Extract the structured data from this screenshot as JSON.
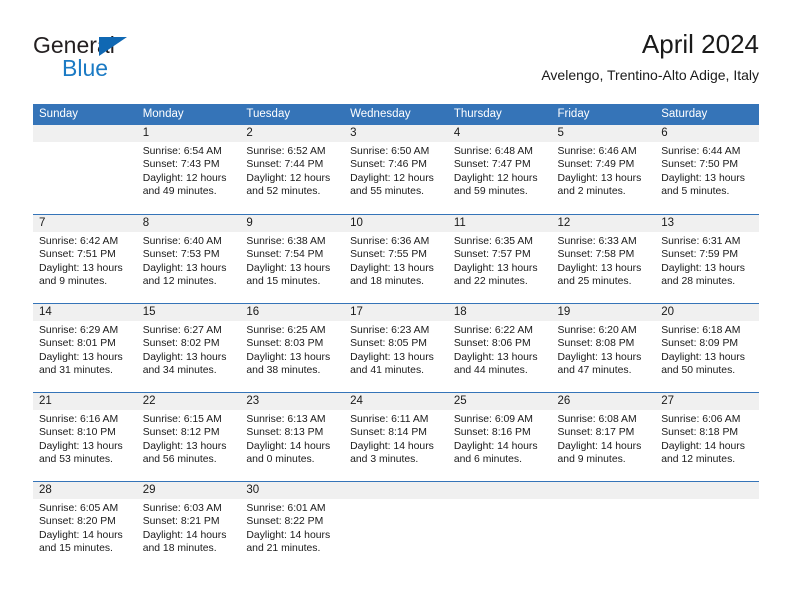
{
  "brand": {
    "name_part1": "General",
    "name_part2": "Blue",
    "triangle_icon": "triangle-icon",
    "accent_color": "#1b7ac4",
    "dark_color": "#231f20"
  },
  "header": {
    "title": "April 2024",
    "subtitle": "Avelengo, Trentino-Alto Adige, Italy"
  },
  "calendar": {
    "header_bg": "#3574b8",
    "day_band_bg": "#f0f0f0",
    "weekday_headers": [
      "Sunday",
      "Monday",
      "Tuesday",
      "Wednesday",
      "Thursday",
      "Friday",
      "Saturday"
    ],
    "weeks": [
      [
        {
          "day": "",
          "sunrise": "",
          "sunset": "",
          "daylight_line1": "",
          "daylight_line2": "",
          "empty": true
        },
        {
          "day": "1",
          "sunrise": "Sunrise: 6:54 AM",
          "sunset": "Sunset: 7:43 PM",
          "daylight_line1": "Daylight: 12 hours",
          "daylight_line2": "and 49 minutes."
        },
        {
          "day": "2",
          "sunrise": "Sunrise: 6:52 AM",
          "sunset": "Sunset: 7:44 PM",
          "daylight_line1": "Daylight: 12 hours",
          "daylight_line2": "and 52 minutes."
        },
        {
          "day": "3",
          "sunrise": "Sunrise: 6:50 AM",
          "sunset": "Sunset: 7:46 PM",
          "daylight_line1": "Daylight: 12 hours",
          "daylight_line2": "and 55 minutes."
        },
        {
          "day": "4",
          "sunrise": "Sunrise: 6:48 AM",
          "sunset": "Sunset: 7:47 PM",
          "daylight_line1": "Daylight: 12 hours",
          "daylight_line2": "and 59 minutes."
        },
        {
          "day": "5",
          "sunrise": "Sunrise: 6:46 AM",
          "sunset": "Sunset: 7:49 PM",
          "daylight_line1": "Daylight: 13 hours",
          "daylight_line2": "and 2 minutes."
        },
        {
          "day": "6",
          "sunrise": "Sunrise: 6:44 AM",
          "sunset": "Sunset: 7:50 PM",
          "daylight_line1": "Daylight: 13 hours",
          "daylight_line2": "and 5 minutes."
        }
      ],
      [
        {
          "day": "7",
          "sunrise": "Sunrise: 6:42 AM",
          "sunset": "Sunset: 7:51 PM",
          "daylight_line1": "Daylight: 13 hours",
          "daylight_line2": "and 9 minutes."
        },
        {
          "day": "8",
          "sunrise": "Sunrise: 6:40 AM",
          "sunset": "Sunset: 7:53 PM",
          "daylight_line1": "Daylight: 13 hours",
          "daylight_line2": "and 12 minutes."
        },
        {
          "day": "9",
          "sunrise": "Sunrise: 6:38 AM",
          "sunset": "Sunset: 7:54 PM",
          "daylight_line1": "Daylight: 13 hours",
          "daylight_line2": "and 15 minutes."
        },
        {
          "day": "10",
          "sunrise": "Sunrise: 6:36 AM",
          "sunset": "Sunset: 7:55 PM",
          "daylight_line1": "Daylight: 13 hours",
          "daylight_line2": "and 18 minutes."
        },
        {
          "day": "11",
          "sunrise": "Sunrise: 6:35 AM",
          "sunset": "Sunset: 7:57 PM",
          "daylight_line1": "Daylight: 13 hours",
          "daylight_line2": "and 22 minutes."
        },
        {
          "day": "12",
          "sunrise": "Sunrise: 6:33 AM",
          "sunset": "Sunset: 7:58 PM",
          "daylight_line1": "Daylight: 13 hours",
          "daylight_line2": "and 25 minutes."
        },
        {
          "day": "13",
          "sunrise": "Sunrise: 6:31 AM",
          "sunset": "Sunset: 7:59 PM",
          "daylight_line1": "Daylight: 13 hours",
          "daylight_line2": "and 28 minutes."
        }
      ],
      [
        {
          "day": "14",
          "sunrise": "Sunrise: 6:29 AM",
          "sunset": "Sunset: 8:01 PM",
          "daylight_line1": "Daylight: 13 hours",
          "daylight_line2": "and 31 minutes."
        },
        {
          "day": "15",
          "sunrise": "Sunrise: 6:27 AM",
          "sunset": "Sunset: 8:02 PM",
          "daylight_line1": "Daylight: 13 hours",
          "daylight_line2": "and 34 minutes."
        },
        {
          "day": "16",
          "sunrise": "Sunrise: 6:25 AM",
          "sunset": "Sunset: 8:03 PM",
          "daylight_line1": "Daylight: 13 hours",
          "daylight_line2": "and 38 minutes."
        },
        {
          "day": "17",
          "sunrise": "Sunrise: 6:23 AM",
          "sunset": "Sunset: 8:05 PM",
          "daylight_line1": "Daylight: 13 hours",
          "daylight_line2": "and 41 minutes."
        },
        {
          "day": "18",
          "sunrise": "Sunrise: 6:22 AM",
          "sunset": "Sunset: 8:06 PM",
          "daylight_line1": "Daylight: 13 hours",
          "daylight_line2": "and 44 minutes."
        },
        {
          "day": "19",
          "sunrise": "Sunrise: 6:20 AM",
          "sunset": "Sunset: 8:08 PM",
          "daylight_line1": "Daylight: 13 hours",
          "daylight_line2": "and 47 minutes."
        },
        {
          "day": "20",
          "sunrise": "Sunrise: 6:18 AM",
          "sunset": "Sunset: 8:09 PM",
          "daylight_line1": "Daylight: 13 hours",
          "daylight_line2": "and 50 minutes."
        }
      ],
      [
        {
          "day": "21",
          "sunrise": "Sunrise: 6:16 AM",
          "sunset": "Sunset: 8:10 PM",
          "daylight_line1": "Daylight: 13 hours",
          "daylight_line2": "and 53 minutes."
        },
        {
          "day": "22",
          "sunrise": "Sunrise: 6:15 AM",
          "sunset": "Sunset: 8:12 PM",
          "daylight_line1": "Daylight: 13 hours",
          "daylight_line2": "and 56 minutes."
        },
        {
          "day": "23",
          "sunrise": "Sunrise: 6:13 AM",
          "sunset": "Sunset: 8:13 PM",
          "daylight_line1": "Daylight: 14 hours",
          "daylight_line2": "and 0 minutes."
        },
        {
          "day": "24",
          "sunrise": "Sunrise: 6:11 AM",
          "sunset": "Sunset: 8:14 PM",
          "daylight_line1": "Daylight: 14 hours",
          "daylight_line2": "and 3 minutes."
        },
        {
          "day": "25",
          "sunrise": "Sunrise: 6:09 AM",
          "sunset": "Sunset: 8:16 PM",
          "daylight_line1": "Daylight: 14 hours",
          "daylight_line2": "and 6 minutes."
        },
        {
          "day": "26",
          "sunrise": "Sunrise: 6:08 AM",
          "sunset": "Sunset: 8:17 PM",
          "daylight_line1": "Daylight: 14 hours",
          "daylight_line2": "and 9 minutes."
        },
        {
          "day": "27",
          "sunrise": "Sunrise: 6:06 AM",
          "sunset": "Sunset: 8:18 PM",
          "daylight_line1": "Daylight: 14 hours",
          "daylight_line2": "and 12 minutes."
        }
      ],
      [
        {
          "day": "28",
          "sunrise": "Sunrise: 6:05 AM",
          "sunset": "Sunset: 8:20 PM",
          "daylight_line1": "Daylight: 14 hours",
          "daylight_line2": "and 15 minutes."
        },
        {
          "day": "29",
          "sunrise": "Sunrise: 6:03 AM",
          "sunset": "Sunset: 8:21 PM",
          "daylight_line1": "Daylight: 14 hours",
          "daylight_line2": "and 18 minutes."
        },
        {
          "day": "30",
          "sunrise": "Sunrise: 6:01 AM",
          "sunset": "Sunset: 8:22 PM",
          "daylight_line1": "Daylight: 14 hours",
          "daylight_line2": "and 21 minutes."
        },
        {
          "day": "",
          "sunrise": "",
          "sunset": "",
          "daylight_line1": "",
          "daylight_line2": "",
          "empty": true
        },
        {
          "day": "",
          "sunrise": "",
          "sunset": "",
          "daylight_line1": "",
          "daylight_line2": "",
          "empty": true
        },
        {
          "day": "",
          "sunrise": "",
          "sunset": "",
          "daylight_line1": "",
          "daylight_line2": "",
          "empty": true
        },
        {
          "day": "",
          "sunrise": "",
          "sunset": "",
          "daylight_line1": "",
          "daylight_line2": "",
          "empty": true
        }
      ]
    ]
  }
}
